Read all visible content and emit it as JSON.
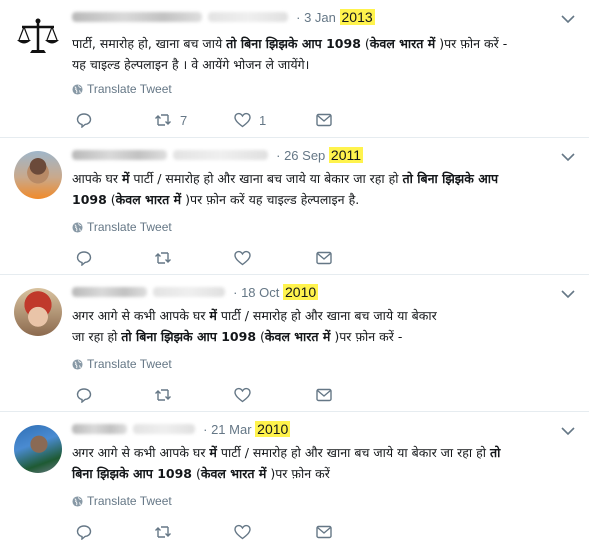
{
  "translate_label": "Translate Tweet",
  "tweets": [
    {
      "date_prefix": "· 3 Jan ",
      "year": "2013",
      "text_a": "पार्टी, समारोह हो, खाना बच जाये ",
      "text_b": "तो बिना झिझके आप 1098",
      "text_c": " (",
      "text_d": "केवल भारत में",
      "text_e": " )पर फ़ोन करें -",
      "line2": "यह चाइल्ड हेल्पलाइन है । वे आयेंगे भोजन ले जायेंगे।",
      "retweets": "7",
      "likes": "1"
    },
    {
      "date_prefix": "· 26 Sep ",
      "year": "2011",
      "line1_a": "आपके घर ",
      "line1_b": "में",
      "line1_c": " पार्टी / समारोह हो और खाना बच जाये या बेकार जा रहा हो ",
      "line1_d": "तो बिना झिझके आप",
      "line2_a": "1098",
      "line2_b": " (",
      "line2_c": "केवल भारत में",
      "line2_d": " )पर फ़ोन करें यह चाइल्ड हेल्पलाइन है."
    },
    {
      "date_prefix": "· 18 Oct ",
      "year": "2010",
      "line1_a": "अगर आगे से कभी आपके घर ",
      "line1_b": "में",
      "line1_c": " पार्टी / समारोह हो और खाना बच जाये या बेकार",
      "line2_a": "जा रहा हो ",
      "line2_b": "तो बिना झिझके आप 1098",
      "line2_c": " (",
      "line2_d": "केवल भारत में",
      "line2_e": " )पर फ़ोन करें -"
    },
    {
      "date_prefix": "· 21 Mar ",
      "year": "2010",
      "line1_a": "अगर आगे से कभी आपके घर ",
      "line1_b": "में",
      "line1_c": " पार्टी / समारोह हो और खाना बच जाये या बेकार जा रहा हो ",
      "line1_d": "तो",
      "line2_a": "बिना झिझके आप  1098",
      "line2_b": " (",
      "line2_c": "केवल भारत में",
      "line2_d": " )पर फ़ोन करें"
    }
  ],
  "colors": {
    "highlight": "#fff34d",
    "muted": "#657786",
    "divider": "#e6ecf0"
  },
  "icons": [
    "justice-scales-icon",
    "globe-icon",
    "reply-icon",
    "retweet-icon",
    "like-icon",
    "message-icon",
    "chevron-down-icon"
  ]
}
